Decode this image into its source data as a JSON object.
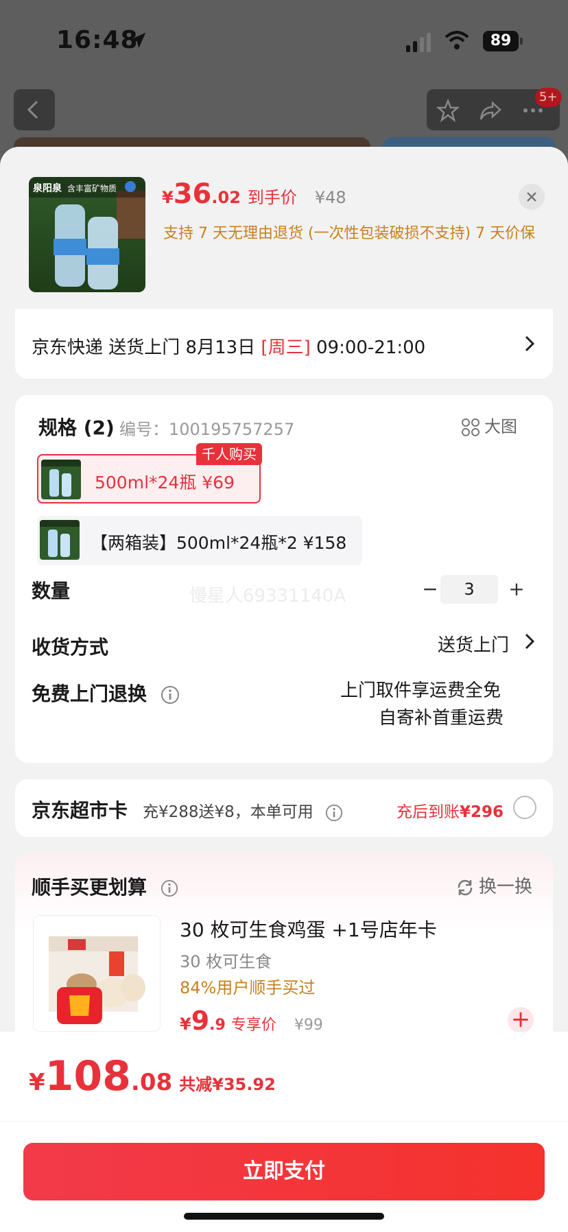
{
  "status": {
    "time": "16:48",
    "battery": "89"
  },
  "badge": "5+",
  "header": {
    "price_yen": "¥",
    "price_int": "36",
    "price_dec": ".02",
    "price_tag": "到手价",
    "orig_price": "¥48",
    "policy": "支持 7 天无理由退货 (一次性包装破损不支持)   7 天价保",
    "thumb_brand": "泉阳泉",
    "thumb_caption": "含丰富矿物质"
  },
  "delivery": {
    "prefix": "京东快递 送货上门 8月13日 ",
    "weekday": "[周三]",
    "suffix": " 09:00-21:00"
  },
  "spec": {
    "title": "规格 (2)",
    "code": "编号：100195757257",
    "big_image": "大图",
    "options": [
      {
        "label": "500ml*24瓶   ¥69",
        "tag": "千人购买",
        "selected": true
      },
      {
        "label": "【两箱装】500ml*24瓶*2   ¥158",
        "selected": false
      }
    ],
    "watermark": "慢星人69331140A"
  },
  "quantity": {
    "label": "数量",
    "minus": "−",
    "value": "3",
    "plus": "+"
  },
  "shipping": {
    "label": "收货方式",
    "value": "送货上门"
  },
  "returns": {
    "label": "免费上门退换",
    "line1": "上门取件享运费全免",
    "line2": "自寄补首重运费"
  },
  "supermarket_card": {
    "title": "京东超市卡",
    "desc": "充¥288送¥8，本单可用",
    "after_prefix": "充后到账",
    "after_value": "¥296"
  },
  "bundle": {
    "title": "顺手买更划算",
    "swap": "换一换",
    "item": {
      "name": "30 枚可生食鸡蛋 +1号店年卡",
      "sub": "30 枚可生食",
      "pct": "84%用户顺手买过",
      "price_yen": "¥",
      "price_int": "9",
      "price_dec": ".9",
      "price_tag": "专享价",
      "orig": "¥99",
      "plus": "+"
    }
  },
  "footer": {
    "yen": "¥",
    "int": "108",
    "dec": ".08",
    "savings": "共减¥35.92",
    "pay_label": "立即支付"
  },
  "colors": {
    "accent": "#e8313a",
    "policy": "#c8801d"
  }
}
